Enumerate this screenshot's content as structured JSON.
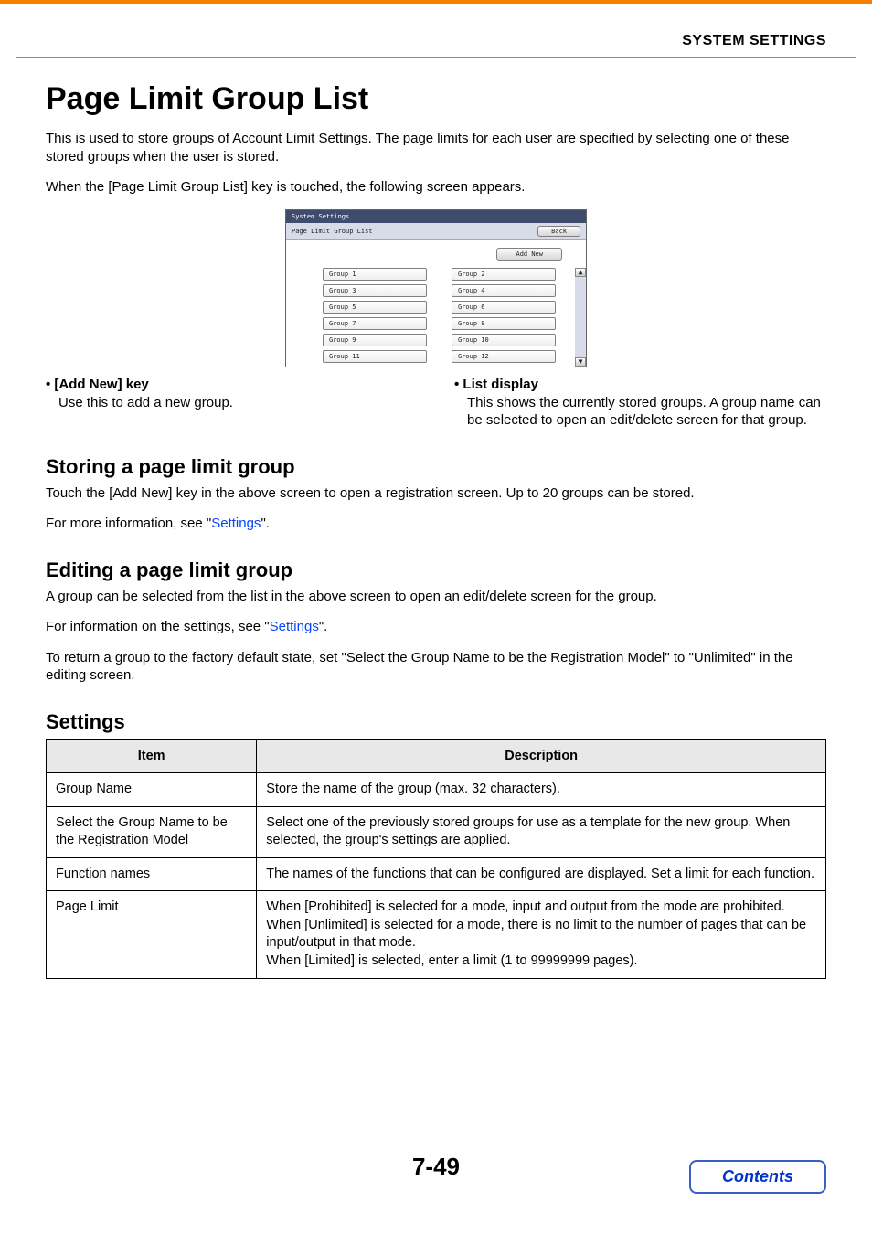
{
  "header": {
    "section_title": "SYSTEM SETTINGS"
  },
  "page": {
    "title": "Page Limit Group List",
    "intro1": "This is used to store groups of Account Limit Settings. The page limits for each user are specified by selecting one of these stored groups when the user is stored.",
    "intro2": "When the [Page Limit Group List] key is touched, the following screen appears."
  },
  "screenshot": {
    "title": "System Settings",
    "subtitle": "Page Limit Group List",
    "back": "Back",
    "add_new": "Add New",
    "groups": [
      "Group 1",
      "Group 2",
      "Group 3",
      "Group 4",
      "Group 5",
      "Group 6",
      "Group 7",
      "Group 8",
      "Group 9",
      "Group 10",
      "Group 11",
      "Group 12"
    ]
  },
  "bullets": {
    "left_title": "• [Add New] key",
    "left_body": "Use this to add a new group.",
    "right_title": "• List display",
    "right_body": "This shows the currently stored groups. A group name can be selected to open an edit/delete screen for that group."
  },
  "storing": {
    "heading": "Storing a page limit group",
    "body1": "Touch the [Add New] key in the above screen to open a registration screen. Up to 20 groups can be stored.",
    "body2_pre": "For more information, see \"",
    "body2_link": "Settings",
    "body2_post": "\"."
  },
  "editing": {
    "heading": "Editing a page limit group",
    "body1": "A group can be selected from the list in the above screen to open an edit/delete screen for the group.",
    "body2_pre": "For information on the settings, see \"",
    "body2_link": "Settings",
    "body2_post": "\".",
    "body3": "To return a group to the factory default state, set \"Select the Group Name to be the Registration Model\" to \"Unlimited\" in the editing screen."
  },
  "settings": {
    "heading": "Settings",
    "th_item": "Item",
    "th_desc": "Description",
    "rows": [
      {
        "item": "Group Name",
        "desc": "Store the name of the group (max. 32 characters)."
      },
      {
        "item": "Select the Group Name to be the Registration Model",
        "desc": "Select one of the previously stored groups for use as a template for the new group. When selected, the group's settings are applied."
      },
      {
        "item": "Function names",
        "desc": "The names of the functions that can be configured are displayed. Set a limit for each function."
      },
      {
        "item": "Page Limit",
        "desc": "When [Prohibited] is selected for a mode, input and output from the mode are prohibited.\nWhen [Unlimited] is selected for a mode, there is no limit to the number of pages that can be input/output in that mode.\nWhen [Limited] is selected, enter a limit (1 to 99999999 pages)."
      }
    ]
  },
  "footer": {
    "pagenum": "7-49",
    "contents": "Contents"
  }
}
